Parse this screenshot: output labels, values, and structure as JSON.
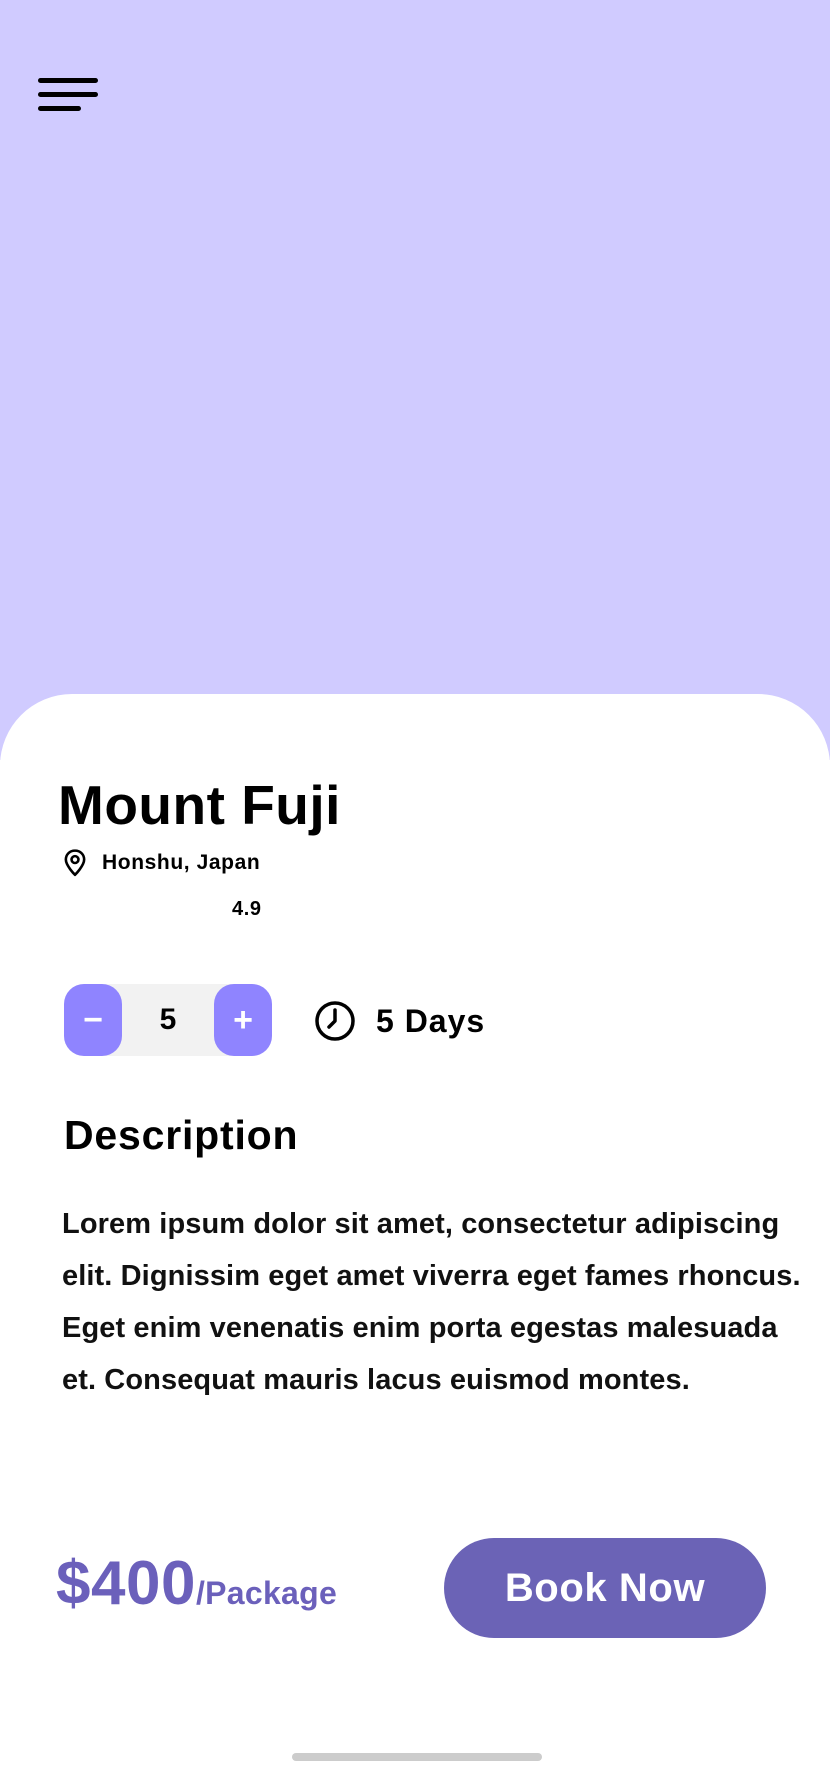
{
  "hero": {
    "background_color": "#d0cbff"
  },
  "menu": {
    "icon": "hamburger-menu-icon"
  },
  "destination": {
    "title": "Mount Fuji",
    "location": "Honshu, Japan",
    "location_icon": "map-pin-icon",
    "rating": "4.9"
  },
  "stepper": {
    "minus_label": "−",
    "quantity": "5",
    "plus_label": "+",
    "accent_color": "#8f84ff"
  },
  "duration": {
    "icon": "clock-icon",
    "label": "5 Days"
  },
  "description": {
    "heading": "Description",
    "body": "Lorem ipsum dolor sit amet, consectetur adipiscing elit. Dignissim eget amet viverra eget fames rhoncus. Eget enim venenatis enim porta egestas malesuada et. Consequat mauris lacus euismod montes."
  },
  "pricing": {
    "amount": "$400",
    "unit": "/Package",
    "color": "#6b60bb"
  },
  "cta": {
    "book_label": "Book Now",
    "color": "#6b63b6"
  }
}
